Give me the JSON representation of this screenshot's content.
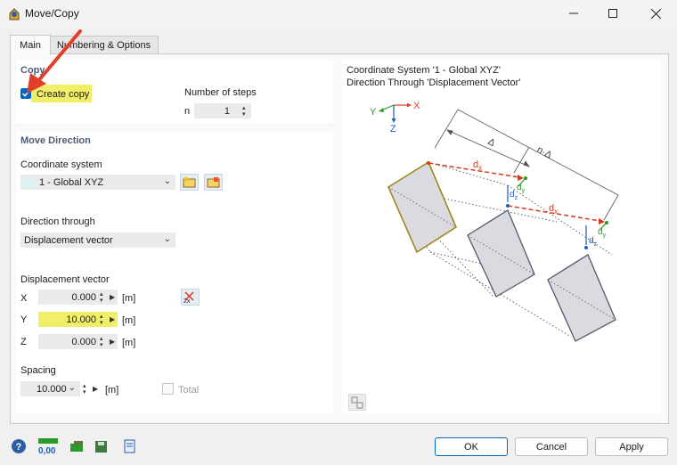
{
  "window": {
    "title": "Move/Copy",
    "minimize_icon": "minimize-icon",
    "maximize_icon": "maximize-icon",
    "close_icon": "close-icon"
  },
  "tabs": [
    {
      "label": "Main"
    },
    {
      "label": "Numbering & Options"
    }
  ],
  "copy": {
    "title": "Copy",
    "create_copy_label": "Create copy",
    "create_copy_checked": true,
    "steps_label": "Number of steps",
    "steps_var": "n",
    "steps_value": "1"
  },
  "move_direction": {
    "title": "Move Direction",
    "coord_label": "Coordinate system",
    "coord_value": "1 - Global XYZ",
    "direction_label": "Direction through",
    "direction_value": "Displacement vector",
    "displacement_label": "Displacement vector",
    "x_label": "X",
    "x_value": "0.000",
    "x_unit": "[m]",
    "y_label": "Y",
    "y_value": "10.000",
    "y_unit": "[m]",
    "z_label": "Z",
    "z_value": "0.000",
    "z_unit": "[m]",
    "spacing_label": "Spacing",
    "spacing_value": "10.000",
    "spacing_unit": "[m]",
    "total_label": "Total",
    "total_checked": false
  },
  "preview": {
    "line1": "Coordinate System '1 - Global XYZ'",
    "line2": "Direction Through 'Displacement Vector'",
    "axis_x": "X",
    "axis_y": "Y",
    "axis_z": "Z",
    "delta_label": "Δ",
    "n_delta_label": "n·Δ",
    "dx": "d",
    "dy": "d",
    "dz": "d",
    "sub_x": "x",
    "sub_y": "y",
    "sub_z": "z"
  },
  "buttons": {
    "ok": "OK",
    "cancel": "Cancel",
    "apply": "Apply"
  },
  "bottom_zero_label": "0,00",
  "colors": {
    "accent": "#0067c0",
    "highlight": "#f1ef6a",
    "arrow_red": "#e0402a",
    "dashed_red": "#d63a1a",
    "green": "#2a9a2a",
    "blue": "#1b5fc0"
  }
}
